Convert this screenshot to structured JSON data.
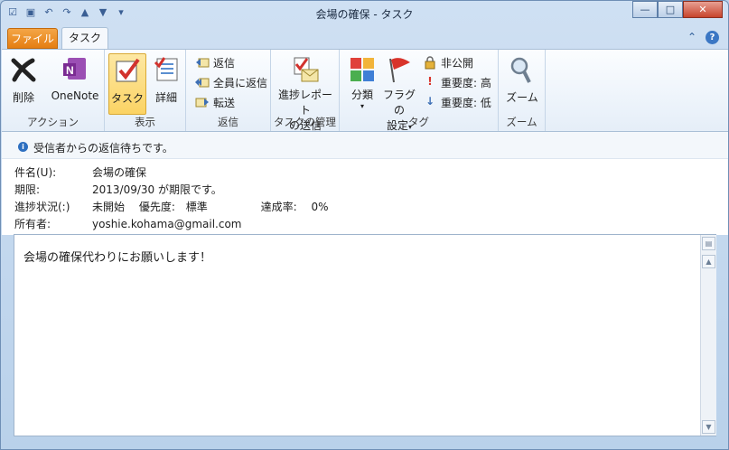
{
  "window": {
    "title": "会場の確保 - タスク"
  },
  "qat": [
    "task-app-icon",
    "save-icon",
    "undo-icon",
    "redo-icon",
    "up-icon",
    "down-icon",
    "customize-icon"
  ],
  "tabs": [
    {
      "label": "ファイル"
    },
    {
      "label": "タスク"
    }
  ],
  "ribbon": {
    "groups": [
      {
        "label": "アクション",
        "items": [
          "削除",
          "OneNote"
        ]
      },
      {
        "label": "表示",
        "items": [
          "タスク",
          "詳細"
        ]
      },
      {
        "label": "返信",
        "items": [
          "返信",
          "全員に返信",
          "転送"
        ]
      },
      {
        "label": "タスクの管理",
        "items": [
          "進捗レポート",
          "の送信"
        ]
      },
      {
        "label": "タグ",
        "items": [
          "分類",
          "フラグの",
          "設定",
          "非公開",
          "重要度: 高",
          "重要度: 低"
        ]
      },
      {
        "label": "ズーム",
        "items": [
          "ズーム"
        ]
      }
    ]
  },
  "info": {
    "banner": "受信者からの返信待ちです。",
    "subject_label": "件名(U):",
    "subject": "会場の確保",
    "due_label": "期限:",
    "due": "2013/09/30 が期限です。",
    "status_label": "進捗状況(:)",
    "status": "未開始",
    "priority_label": "優先度:",
    "priority": "標準",
    "percent_label": "達成率:",
    "percent": "0%",
    "owner_label": "所有者:",
    "owner": "yoshie.kohama@gmail.com"
  },
  "body": {
    "text": "会場の確保代わりにお願いします！"
  },
  "colors": {
    "file_tab": "#e57e12",
    "selected": "#fbd364",
    "accent": "#3b77c4"
  }
}
